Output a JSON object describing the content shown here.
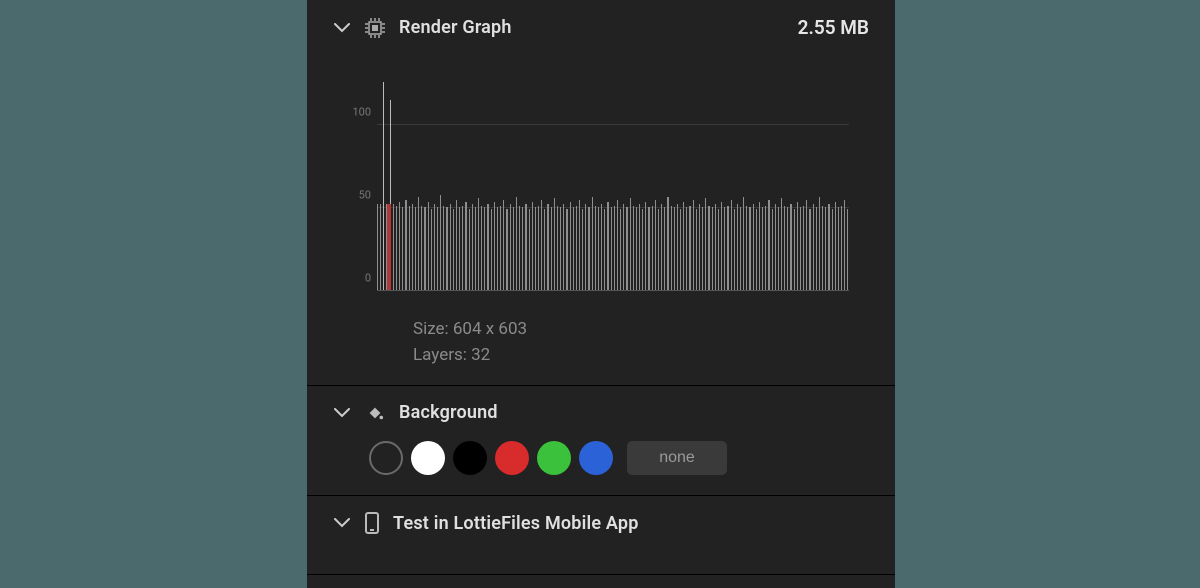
{
  "render_graph": {
    "title": "Render Graph",
    "filesize": "2.55 MB",
    "size_label": "Size: 604 x 603",
    "layers_label": "Layers: 32"
  },
  "background": {
    "title": "Background",
    "none_label": "none",
    "swatches": [
      "transparent",
      "#ffffff",
      "#000000",
      "#d82b2b",
      "#3bc13b",
      "#2b62d8"
    ]
  },
  "test_section": {
    "title": "Test in LottieFiles Mobile App"
  },
  "chart_data": {
    "type": "bar",
    "title": "Render Graph",
    "xlabel": "",
    "ylabel": "",
    "ylim": [
      0,
      120
    ],
    "yticks": [
      0,
      50,
      100
    ],
    "playhead_index": 3,
    "values": [
      48,
      48,
      115,
      48,
      105,
      48,
      47,
      49,
      46,
      50,
      47,
      48,
      46,
      52,
      47,
      46,
      49,
      45,
      48,
      46,
      53,
      47,
      46,
      48,
      45,
      50,
      46,
      47,
      49,
      45,
      48,
      46,
      51,
      47,
      46,
      48,
      45,
      49,
      46,
      47,
      50,
      45,
      48,
      46,
      52,
      47,
      46,
      48,
      45,
      49,
      46,
      47,
      50,
      45,
      48,
      46,
      51,
      47,
      46,
      48,
      45,
      49,
      46,
      47,
      50,
      45,
      48,
      46,
      52,
      47,
      46,
      48,
      45,
      49,
      46,
      47,
      50,
      45,
      48,
      46,
      51,
      47,
      46,
      48,
      45,
      49,
      46,
      47,
      50,
      45,
      48,
      46,
      52,
      47,
      46,
      48,
      45,
      49,
      46,
      47,
      50,
      45,
      48,
      46,
      51,
      47,
      46,
      48,
      45,
      49,
      46,
      47,
      50,
      45,
      48,
      46,
      52,
      47,
      46,
      48,
      45,
      49,
      46,
      47,
      50,
      45,
      48,
      46,
      51,
      47,
      46,
      48,
      45,
      49,
      46,
      47,
      50,
      45,
      48,
      46,
      52,
      47,
      46,
      48,
      45,
      49,
      46,
      47,
      50,
      45
    ]
  }
}
